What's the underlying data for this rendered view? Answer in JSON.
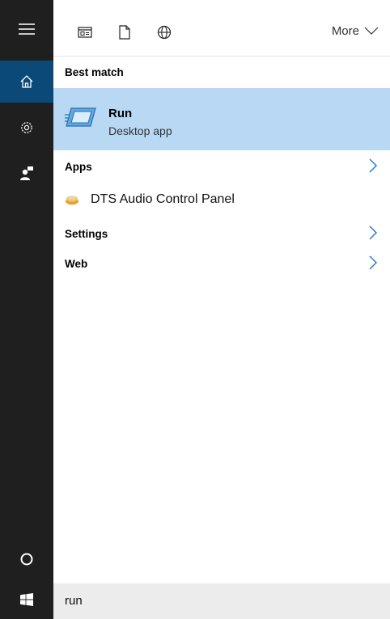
{
  "rail": {
    "items": [
      {
        "name": "hamburger-icon"
      },
      {
        "name": "home-icon",
        "active": true
      },
      {
        "name": "settings-icon"
      },
      {
        "name": "feedback-icon"
      }
    ],
    "bottom": {
      "name": "cortana-circle-icon"
    },
    "start": {
      "name": "windows-logo-icon"
    }
  },
  "toolbar": {
    "filters": [
      "apps-filter-icon",
      "documents-filter-icon",
      "web-filter-icon"
    ],
    "more_label": "More"
  },
  "results": {
    "best_match_heading": "Best match",
    "best_match": {
      "title": "Run",
      "subtitle": "Desktop app"
    },
    "apps_heading": "Apps",
    "apps": [
      {
        "label": "DTS Audio Control Panel"
      }
    ],
    "settings_heading": "Settings",
    "web_heading": "Web"
  },
  "search": {
    "value": "run"
  },
  "colors": {
    "rail": "#1f1f1f",
    "active": "#0b4a78",
    "highlight": "#b8d8f3",
    "accent": "#2d7cc8"
  }
}
